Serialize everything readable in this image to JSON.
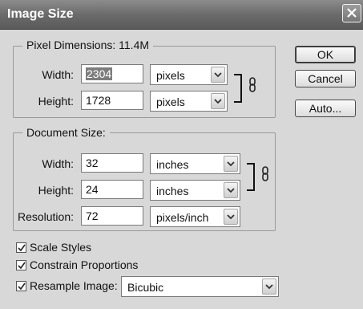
{
  "window": {
    "title": "Image Size",
    "close_icon": "close-icon"
  },
  "pixel_dimensions": {
    "legend": "Pixel Dimensions:  11.4M",
    "width_label": "Width:",
    "width_value": "2304",
    "width_unit": "pixels",
    "height_label": "Height:",
    "height_value": "1728",
    "height_unit": "pixels",
    "link_icon": "chain-link-icon"
  },
  "document_size": {
    "legend": "Document Size:",
    "width_label": "Width:",
    "width_value": "32",
    "width_unit": "inches",
    "height_label": "Height:",
    "height_value": "24",
    "height_unit": "inches",
    "resolution_label": "Resolution:",
    "resolution_value": "72",
    "resolution_unit": "pixels/inch",
    "link_icon": "chain-link-icon"
  },
  "options": {
    "scale_styles": {
      "label": "Scale Styles",
      "checked": true
    },
    "constrain_proportions": {
      "label": "Constrain Proportions",
      "checked": true
    },
    "resample_image": {
      "label": "Resample Image:",
      "checked": true,
      "method": "Bicubic"
    }
  },
  "buttons": {
    "ok": "OK",
    "cancel": "Cancel",
    "auto": "Auto..."
  }
}
